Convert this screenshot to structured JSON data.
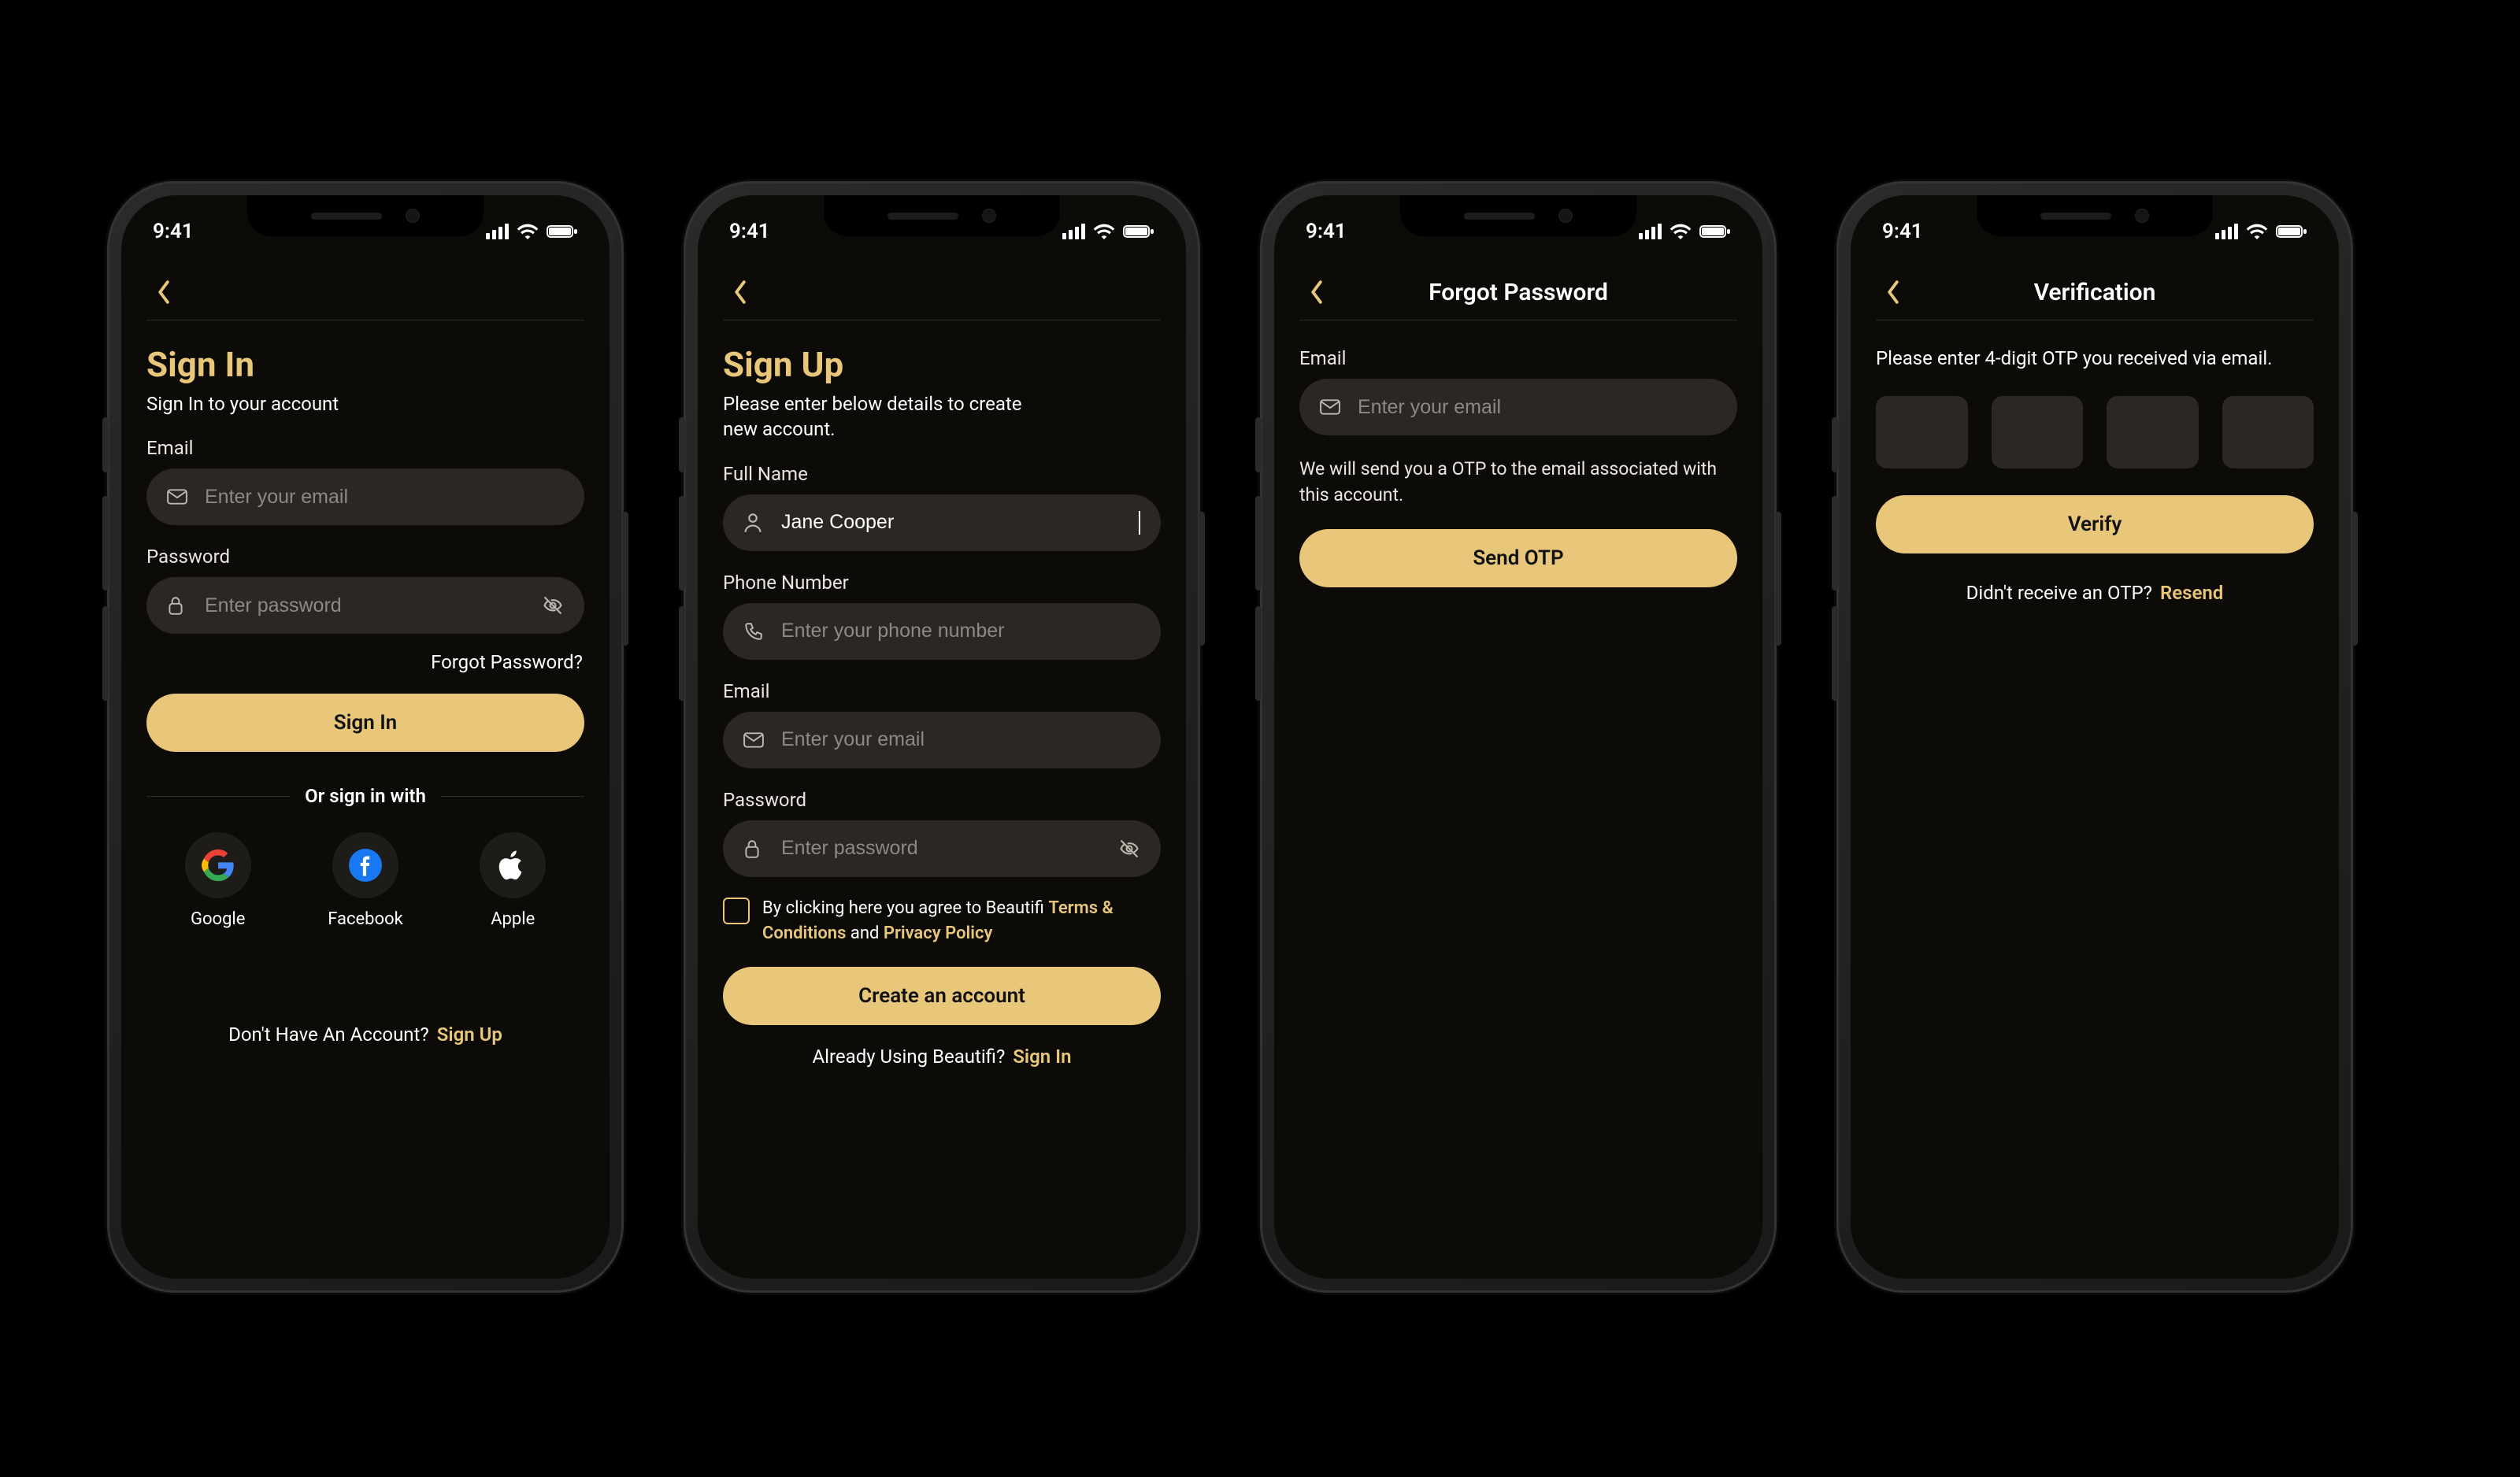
{
  "status": {
    "time": "9:41"
  },
  "colors": {
    "accent": "#e8c67a"
  },
  "signin": {
    "title": "Sign In",
    "subtitle": "Sign In to your account",
    "email_label": "Email",
    "email_placeholder": "Enter your email",
    "password_label": "Password",
    "password_placeholder": "Enter password",
    "forgot": "Forgot Password?",
    "submit": "Sign In",
    "or_divider": "Or sign in with",
    "socials": {
      "google": "Google",
      "facebook": "Facebook",
      "apple": "Apple"
    },
    "no_account_text": "Don't Have An Account?",
    "signup_link": "Sign Up"
  },
  "signup": {
    "title": "Sign Up",
    "subtitle": "Please enter below details to create new account.",
    "fullname_label": "Full Name",
    "fullname_value": "Jane Cooper",
    "phone_label": "Phone Number",
    "phone_placeholder": "Enter your phone number",
    "email_label": "Email",
    "email_placeholder": "Enter your email",
    "password_label": "Password",
    "password_placeholder": "Enter password",
    "consent_prefix": "By clicking here you agree to Beautifi ",
    "terms": "Terms & Conditions",
    "and": " and ",
    "privacy": "Privacy Policy",
    "submit": "Create an account",
    "already_text": "Already Using Beautifi?",
    "signin_link": "Sign In"
  },
  "forgot": {
    "title": "Forgot Password",
    "email_label": "Email",
    "email_placeholder": "Enter your email",
    "helper": "We will send you a OTP to the email associated with this account.",
    "submit": "Send OTP"
  },
  "verify": {
    "title": "Verification",
    "subtitle": "Please enter 4-digit OTP you received via email.",
    "submit": "Verify",
    "no_otp_text": "Didn't receive an OTP?",
    "resend": "Resend"
  }
}
